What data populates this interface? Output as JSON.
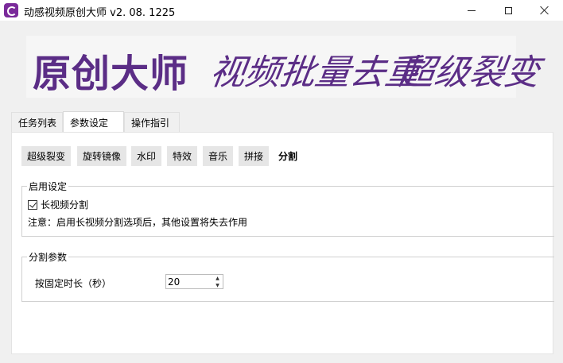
{
  "window": {
    "title": "动感视频原创大师  v2. 08. 1225",
    "minimize": "",
    "maximize": "",
    "close": ""
  },
  "banner": {
    "main_text": "原创大师",
    "sub_text_1": "视频批量去重",
    "sub_text_2": "超级裂变"
  },
  "tabs": [
    {
      "label": "任务列表",
      "active": false
    },
    {
      "label": "参数设定",
      "active": true
    },
    {
      "label": "操作指引",
      "active": false
    }
  ],
  "subtabs": [
    {
      "label": "超级裂变"
    },
    {
      "label": "旋转镜像"
    },
    {
      "label": "水印"
    },
    {
      "label": "特效"
    },
    {
      "label": "音乐"
    },
    {
      "label": "拼接"
    },
    {
      "label": "分割",
      "active": true
    }
  ],
  "enable_group": {
    "title": "启用设定",
    "checkbox_label": "长视频分割",
    "checkbox_checked": true,
    "note": "注意：启用长视频分割选项后，其他设置将失去作用"
  },
  "split_group": {
    "title": "分割参数",
    "duration_label": "按固定时长（秒）",
    "duration_value": "20"
  },
  "colors": {
    "banner_text": "#5b2d86",
    "app_icon": "#7a2a9a"
  },
  "icons": {
    "app": "app-logo-icon",
    "minimize": "minimize-icon",
    "maximize": "maximize-icon",
    "close": "close-icon",
    "check": "check-icon",
    "spin_up": "caret-up-icon",
    "spin_down": "caret-down-icon"
  }
}
